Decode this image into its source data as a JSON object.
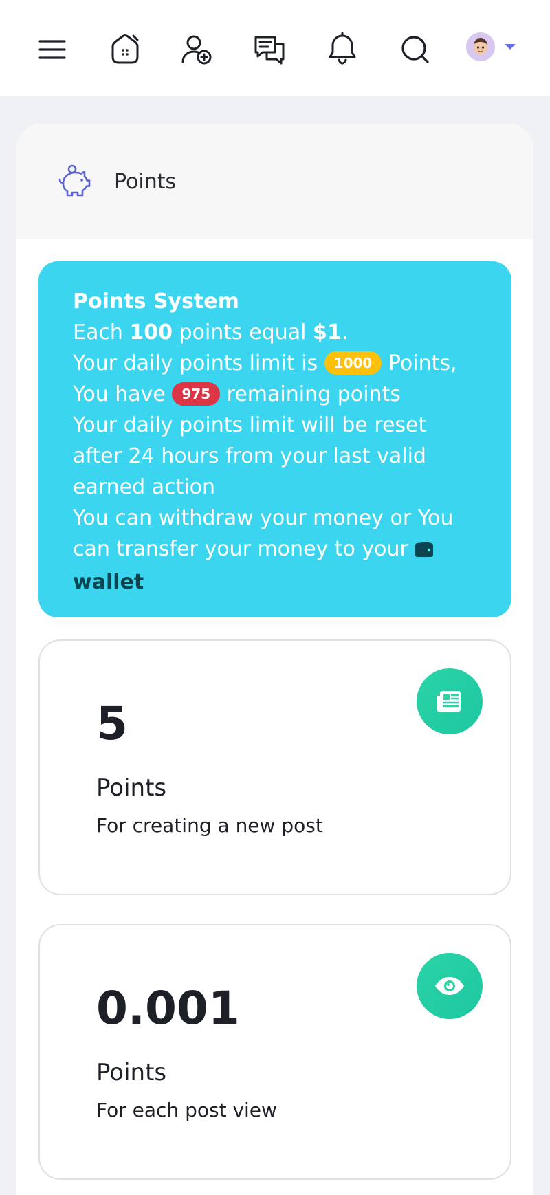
{
  "nav": {
    "icons": [
      "menu-icon",
      "home-icon",
      "add-friend-icon",
      "messages-icon",
      "notifications-icon",
      "search-icon"
    ],
    "accent": "#6a6fe0"
  },
  "page": {
    "title": "Points",
    "title_icon": "piggy-bank-icon",
    "icon_color": "#5b63d3"
  },
  "points_system": {
    "heading": "Points System",
    "line1_pre": "Each ",
    "line1_points": "100",
    "line1_mid": " points equal ",
    "line1_amount": "$1",
    "line1_end": ".",
    "line2_pre": "Your daily points limit is ",
    "daily_limit": "1000",
    "line2_post": " Points,",
    "line3_pre": "You have ",
    "remaining": "975",
    "line3_post": " remaining points",
    "line4": "Your daily points limit will be reset after 24 hours from your last valid earned action",
    "line5": "You can withdraw your money or You can transfer your money to your ",
    "wallet_label": "wallet",
    "wallet_icon": "wallet-icon",
    "bg_color": "#3bd5f0"
  },
  "stats": [
    {
      "value": "5",
      "label": "Points",
      "description": "For creating a new post",
      "icon": "newspaper-icon"
    },
    {
      "value": "0.001",
      "label": "Points",
      "description": "For each post view",
      "icon": "eye-icon"
    }
  ]
}
